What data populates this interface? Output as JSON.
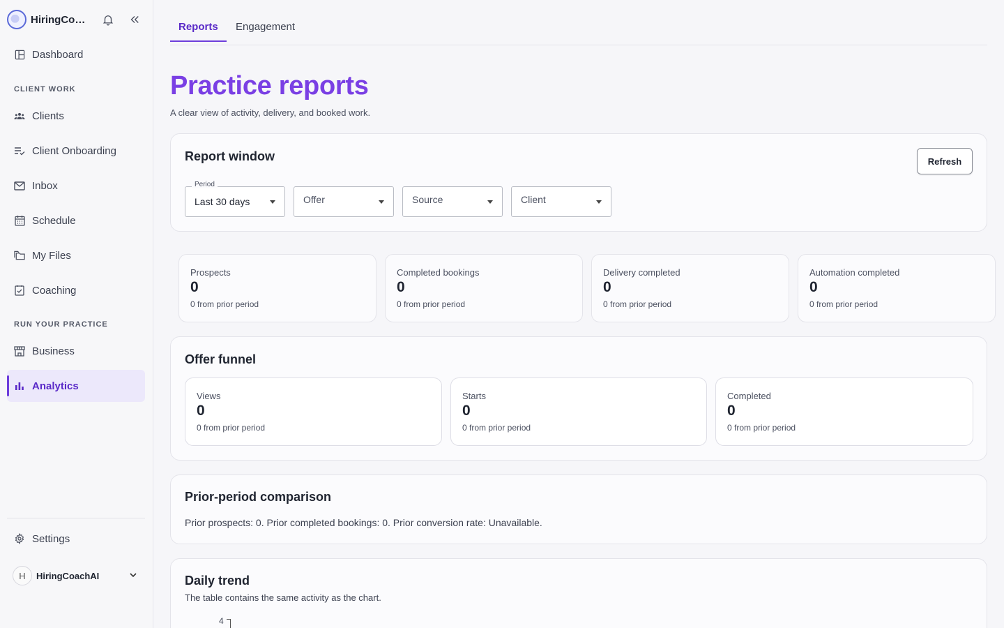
{
  "sidebar": {
    "brand_name": "HiringCoa...",
    "icons": {
      "bell": "bell-icon",
      "collapse": "chevrons-left-icon"
    },
    "nav": {
      "dashboard": "Dashboard",
      "section_client_work": "CLIENT WORK",
      "clients": "Clients",
      "client_onboarding": "Client Onboarding",
      "inbox": "Inbox",
      "schedule": "Schedule",
      "my_files": "My Files",
      "coaching": "Coaching",
      "section_run_practice": "RUN YOUR PRACTICE",
      "business": "Business",
      "analytics": "Analytics",
      "settings": "Settings"
    },
    "active_item": "Analytics",
    "account": {
      "avatar_initial": "H",
      "name": "HiringCoachAI"
    }
  },
  "tabs": [
    {
      "label": "Reports",
      "active": true
    },
    {
      "label": "Engagement",
      "active": false
    }
  ],
  "page": {
    "title": "Practice reports",
    "subtitle": "A clear view of activity, delivery, and booked work."
  },
  "report_window": {
    "title": "Report window",
    "refresh_label": "Refresh",
    "filters": {
      "period": {
        "label": "Period",
        "value": "Last 30 days"
      },
      "offer": {
        "placeholder": "Offer"
      },
      "source": {
        "placeholder": "Source"
      },
      "client": {
        "placeholder": "Client"
      }
    }
  },
  "metrics": [
    {
      "label": "Prospects",
      "value": "0",
      "delta": "0 from prior period"
    },
    {
      "label": "Completed bookings",
      "value": "0",
      "delta": "0 from prior period"
    },
    {
      "label": "Delivery completed",
      "value": "0",
      "delta": "0 from prior period"
    },
    {
      "label": "Automation completed",
      "value": "0",
      "delta": "0 from prior period"
    }
  ],
  "offer_funnel": {
    "title": "Offer funnel",
    "steps": [
      {
        "label": "Views",
        "value": "0",
        "delta": "0 from prior period"
      },
      {
        "label": "Starts",
        "value": "0",
        "delta": "0 from prior period"
      },
      {
        "label": "Completed",
        "value": "0",
        "delta": "0 from prior period"
      }
    ]
  },
  "comparison": {
    "title": "Prior-period comparison",
    "text": "Prior prospects: 0. Prior completed bookings: 0. Prior conversion rate: Unavailable."
  },
  "daily_trend": {
    "title": "Daily trend",
    "subtitle": "The table contains the same activity as the chart.",
    "y_tick_top": "4"
  },
  "colors": {
    "accent": "#6d3ddb",
    "title_purple": "#7a3fe4",
    "active_bg": "#ece8fb"
  }
}
